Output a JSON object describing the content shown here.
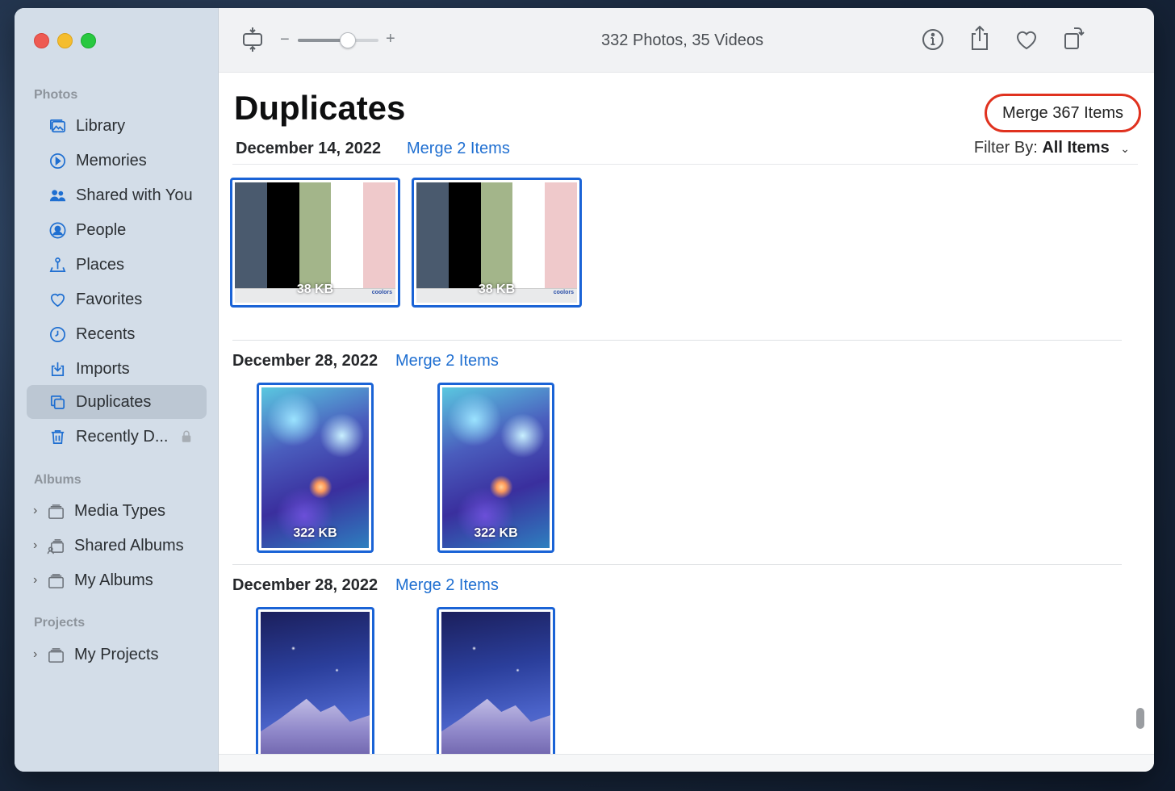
{
  "window": {
    "toolbar": {
      "title": "332 Photos, 35 Videos",
      "zoom_minus": "−",
      "zoom_plus": "+",
      "zoom_level": 0.62
    },
    "accent_color": "#1f6fd1",
    "highlight_color": "#e0321f"
  },
  "sidebar": {
    "sections": [
      {
        "title": "Photos"
      },
      {
        "title": "Albums"
      },
      {
        "title": "Projects"
      }
    ],
    "photos_items": [
      {
        "label": "Library",
        "icon": "library-icon"
      },
      {
        "label": "Memories",
        "icon": "memories-icon"
      },
      {
        "label": "Shared with You",
        "icon": "shared-with-you-icon"
      },
      {
        "label": "People",
        "icon": "people-icon"
      },
      {
        "label": "Places",
        "icon": "places-icon"
      },
      {
        "label": "Favorites",
        "icon": "heart-icon"
      },
      {
        "label": "Recents",
        "icon": "clock-icon"
      },
      {
        "label": "Imports",
        "icon": "import-icon"
      },
      {
        "label": "Duplicates",
        "icon": "duplicates-icon",
        "active": true
      },
      {
        "label": "Recently D...",
        "icon": "trash-icon",
        "locked": true
      }
    ],
    "album_items": [
      {
        "label": "Media Types",
        "icon": "folder-stack-icon"
      },
      {
        "label": "Shared Albums",
        "icon": "shared-albums-icon"
      },
      {
        "label": "My Albums",
        "icon": "folder-stack-icon"
      }
    ],
    "project_items": [
      {
        "label": "My Projects",
        "icon": "folder-stack-icon"
      }
    ]
  },
  "main": {
    "title": "Duplicates",
    "merge_all_label": "Merge 367 Items",
    "filter_prefix": "Filter By:",
    "filter_value": "All Items",
    "groups": [
      {
        "date": "December 14, 2022",
        "merge_label": "Merge 2 Items",
        "items": [
          {
            "size": "38 KB",
            "kind": "palette"
          },
          {
            "size": "38 KB",
            "kind": "palette"
          }
        ]
      },
      {
        "date": "December 28, 2022",
        "merge_label": "Merge 2 Items",
        "items": [
          {
            "size": "322 KB",
            "kind": "snowflakes"
          },
          {
            "size": "322 KB",
            "kind": "snowflakes"
          }
        ]
      },
      {
        "date": "December 28, 2022",
        "merge_label": "Merge 2 Items",
        "items": [
          {
            "size": "",
            "kind": "mountain"
          },
          {
            "size": "",
            "kind": "mountain"
          }
        ]
      }
    ],
    "palette_colors": [
      "#4a5a6e",
      "#000000",
      "#a3b58a",
      "#ffffff",
      "#efc9cb"
    ],
    "palette_brand": "coolors"
  }
}
